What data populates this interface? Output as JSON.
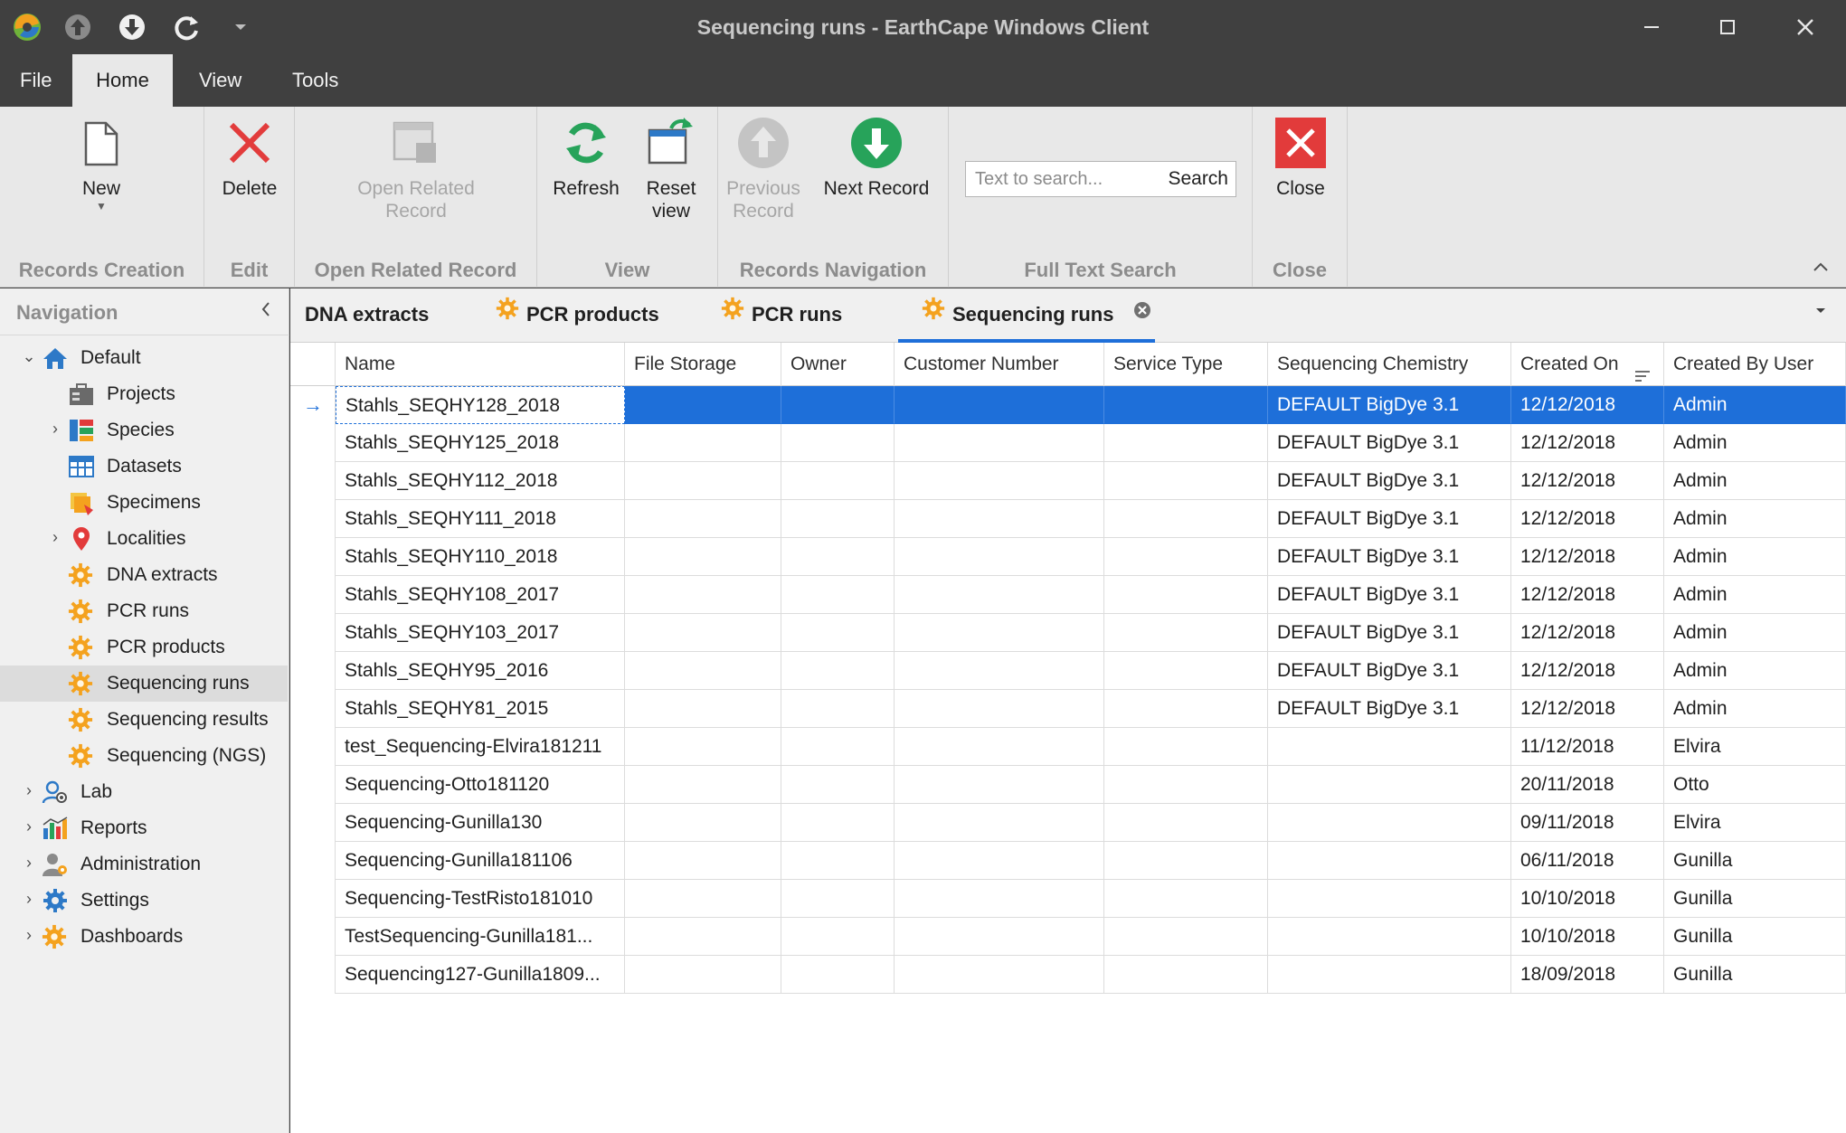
{
  "window": {
    "title": "Sequencing runs - EarthCape Windows Client",
    "controls": [
      "minimize",
      "maximize",
      "close"
    ]
  },
  "menu": {
    "tabs": [
      {
        "label": "File",
        "active": false
      },
      {
        "label": "Home",
        "active": true
      },
      {
        "label": "View",
        "active": false
      },
      {
        "label": "Tools",
        "active": false
      }
    ]
  },
  "ribbon": {
    "new_label": "New",
    "delete_label": "Delete",
    "open_related_label1": "Open Related",
    "open_related_label2": "Record",
    "refresh_label": "Refresh",
    "reset_label1": "Reset",
    "reset_label2": "view",
    "previous_label1": "Previous",
    "previous_label2": "Record",
    "next_label": "Next Record",
    "search_placeholder": "Text to search...",
    "search_button": "Search",
    "close_label": "Close",
    "groups": {
      "records_creation": "Records Creation",
      "edit": "Edit",
      "open_related": "Open Related Record",
      "view": "View",
      "records_navigation": "Records Navigation",
      "full_text_search": "Full Text Search",
      "close": "Close"
    }
  },
  "navigation": {
    "title": "Navigation",
    "items": [
      {
        "label": "Default",
        "icon": "home-icon"
      },
      {
        "label": "Projects",
        "icon": "projects-icon"
      },
      {
        "label": "Species",
        "icon": "species-icon"
      },
      {
        "label": "Datasets",
        "icon": "datasets-icon"
      },
      {
        "label": "Specimens",
        "icon": "specimens-icon"
      },
      {
        "label": "Localities",
        "icon": "location-pin-icon"
      },
      {
        "label": "DNA extracts",
        "icon": "gear-icon"
      },
      {
        "label": "PCR runs",
        "icon": "gear-icon"
      },
      {
        "label": "PCR products",
        "icon": "gear-icon"
      },
      {
        "label": "Sequencing runs",
        "icon": "gear-icon",
        "selected": true
      },
      {
        "label": "Sequencing results",
        "icon": "gear-icon"
      },
      {
        "label": "Sequencing (NGS)",
        "icon": "gear-icon"
      },
      {
        "label": "Lab",
        "icon": "lab-icon"
      },
      {
        "label": "Reports",
        "icon": "reports-icon"
      },
      {
        "label": "Administration",
        "icon": "administration-icon"
      },
      {
        "label": "Settings",
        "icon": "settings-icon"
      },
      {
        "label": "Dashboards",
        "icon": "gear-icon"
      }
    ]
  },
  "doc_tabs": [
    {
      "label": "DNA extracts",
      "active": false
    },
    {
      "label": "PCR products",
      "active": false
    },
    {
      "label": "PCR runs",
      "active": false
    },
    {
      "label": "Sequencing runs",
      "active": true
    }
  ],
  "grid": {
    "columns": [
      "Name",
      "File Storage",
      "Owner",
      "Customer Number",
      "Service Type",
      "Sequencing Chemistry",
      "Created On",
      "Created By User"
    ],
    "rows": [
      [
        "Stahls_SEQHY128_2018",
        "",
        "",
        "",
        "",
        "DEFAULT BigDye 3.1",
        "12/12/2018",
        "Admin"
      ],
      [
        "Stahls_SEQHY125_2018",
        "",
        "",
        "",
        "",
        "DEFAULT BigDye 3.1",
        "12/12/2018",
        "Admin"
      ],
      [
        "Stahls_SEQHY112_2018",
        "",
        "",
        "",
        "",
        "DEFAULT BigDye 3.1",
        "12/12/2018",
        "Admin"
      ],
      [
        "Stahls_SEQHY111_2018",
        "",
        "",
        "",
        "",
        "DEFAULT BigDye 3.1",
        "12/12/2018",
        "Admin"
      ],
      [
        "Stahls_SEQHY110_2018",
        "",
        "",
        "",
        "",
        "DEFAULT BigDye 3.1",
        "12/12/2018",
        "Admin"
      ],
      [
        "Stahls_SEQHY108_2017",
        "",
        "",
        "",
        "",
        "DEFAULT BigDye 3.1",
        "12/12/2018",
        "Admin"
      ],
      [
        "Stahls_SEQHY103_2017",
        "",
        "",
        "",
        "",
        "DEFAULT BigDye 3.1",
        "12/12/2018",
        "Admin"
      ],
      [
        "Stahls_SEQHY95_2016",
        "",
        "",
        "",
        "",
        "DEFAULT BigDye 3.1",
        "12/12/2018",
        "Admin"
      ],
      [
        "Stahls_SEQHY81_2015",
        "",
        "",
        "",
        "",
        "DEFAULT BigDye 3.1",
        "12/12/2018",
        "Admin"
      ],
      [
        "test_Sequencing-Elvira181211",
        "",
        "",
        "",
        "",
        "",
        "11/12/2018",
        "Elvira"
      ],
      [
        "Sequencing-Otto181120",
        "",
        "",
        "",
        "",
        "",
        "20/11/2018",
        "Otto"
      ],
      [
        "Sequencing-Gunilla130",
        "",
        "",
        "",
        "",
        "",
        "09/11/2018",
        "Elvira"
      ],
      [
        "Sequencing-Gunilla181106",
        "",
        "",
        "",
        "",
        "",
        "06/11/2018",
        "Gunilla"
      ],
      [
        "Sequencing-TestRisto181010",
        "",
        "",
        "",
        "",
        "",
        "10/10/2018",
        "Gunilla"
      ],
      [
        "TestSequencing-Gunilla181...",
        "",
        "",
        "",
        "",
        "",
        "10/10/2018",
        "Gunilla"
      ],
      [
        "Sequencing127-Gunilla1809...",
        "",
        "",
        "",
        "",
        "",
        "18/09/2018",
        "Gunilla"
      ]
    ],
    "selected_row": 0
  },
  "colors": {
    "accent": "#1e6fd9",
    "delete_red": "#e23b3b",
    "refresh_green": "#27a35a",
    "gear_orange": "#f4a21e"
  }
}
